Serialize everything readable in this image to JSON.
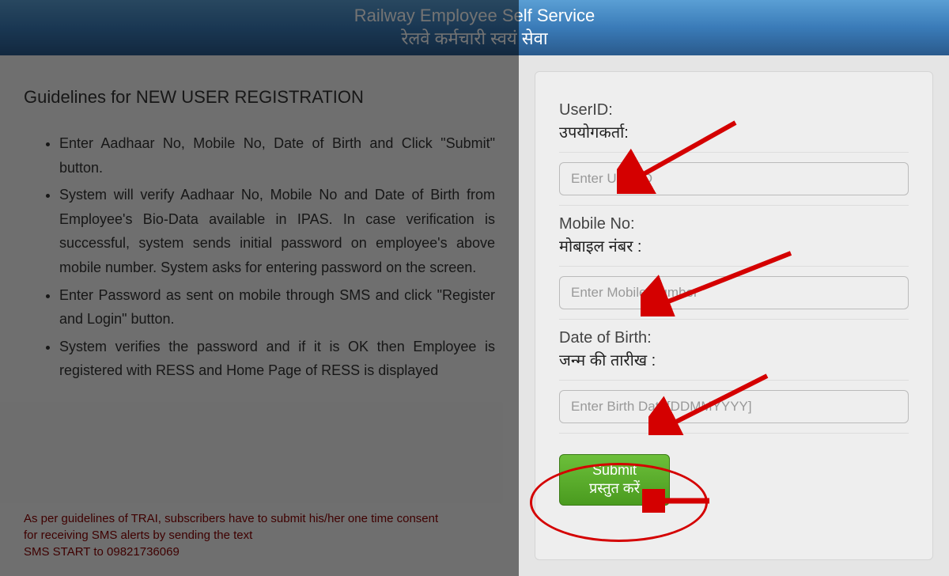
{
  "header": {
    "title_en": "Railway Employee Self Service",
    "title_hi": "रेलवे कर्मचारी स्वयं सेवा"
  },
  "guidelines": {
    "title": "Guidelines for NEW USER REGISTRATION",
    "items": [
      "Enter Aadhaar No, Mobile No, Date of Birth and Click \"Submit\" button.",
      "System will verify Aadhaar No, Mobile No and Date of Birth from Employee's Bio-Data available in IPAS. In case verification is successful, system sends initial password on employee's above mobile number. System asks for entering password on the screen.",
      "Enter Password as sent on mobile through SMS and click \"Register and Login\" button.",
      "System verifies the password and if it is OK then Employee is registered with RESS and Home Page of RESS is displayed"
    ]
  },
  "trai": {
    "line1": "As per guidelines of TRAI, subscribers have to submit his/her one time consent",
    "line2": "for receiving SMS alerts by sending the text",
    "line3": "SMS START to 09821736069"
  },
  "form": {
    "userid": {
      "label_en": "UserID:",
      "label_hi": "उपयोगकर्ता:",
      "placeholder": "Enter User ID"
    },
    "mobile": {
      "label_en": "Mobile No:",
      "label_hi": "मोबाइल नंबर :",
      "placeholder": "Enter Mobile Number"
    },
    "dob": {
      "label_en": "Date of Birth:",
      "label_hi": "जन्म की तारीख :",
      "placeholder": "Enter Birth Date[DDMMYYYY]"
    },
    "submit": {
      "label_en": "Submit",
      "label_hi": "प्रस्तुत करें"
    }
  },
  "colors": {
    "arrow_red": "#d40000",
    "submit_green": "#4a9b1f"
  }
}
